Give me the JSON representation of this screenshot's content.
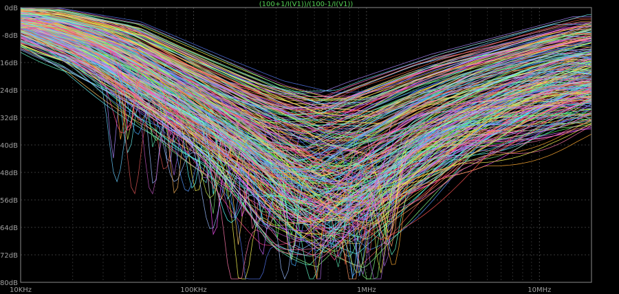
{
  "chart_data": {
    "type": "line",
    "title": "(100+1/I(V1))/(100-1/I(V1))",
    "x_scale": "log",
    "xlim": [
      10000,
      20000000
    ],
    "ylim": [
      -80,
      0
    ],
    "grid": true,
    "x_ticks": [
      {
        "value": 10000,
        "label": "10KHz"
      },
      {
        "value": 100000,
        "label": "100KHz"
      },
      {
        "value": 1000000,
        "label": "1MHz"
      },
      {
        "value": 10000000,
        "label": "10MHz"
      }
    ],
    "y_ticks": [
      {
        "value": 0,
        "label": "0dB"
      },
      {
        "value": -8,
        "label": "-8dB"
      },
      {
        "value": -16,
        "label": "-16dB"
      },
      {
        "value": -24,
        "label": "-24dB"
      },
      {
        "value": -32,
        "label": "-32dB"
      },
      {
        "value": -40,
        "label": "-40dB"
      },
      {
        "value": -48,
        "label": "-48dB"
      },
      {
        "value": -56,
        "label": "-56dB"
      },
      {
        "value": -64,
        "label": "-64dB"
      },
      {
        "value": -72,
        "label": "-72dB"
      },
      {
        "value": -80,
        "label": "-80dB"
      }
    ],
    "series_count": 300,
    "envelope": {
      "x": [
        10000,
        30000,
        100000,
        200000,
        400000,
        700000,
        1000000,
        3000000,
        10000000,
        20000000
      ],
      "upper": [
        0,
        -4,
        -15,
        -21,
        -24.5,
        -24,
        -21,
        -13,
        -6,
        -2
      ],
      "lower": [
        -8,
        -20,
        -40,
        -54,
        -72,
        -77,
        -70,
        -50,
        -40,
        -36
      ]
    },
    "colors": [
      "#ff5555",
      "#55ff55",
      "#5599ff",
      "#ffff55",
      "#ff55ff",
      "#55ffff",
      "#ffaa33",
      "#aa88ff",
      "#ff77aa",
      "#88ff88",
      "#ff9966",
      "#66ccff",
      "#dddd44",
      "#cc66ff",
      "#66ffcc",
      "#ff4488",
      "#44aaff",
      "#ffcc66",
      "#bb55bb",
      "#77dd77",
      "#ee6644",
      "#99bbff",
      "#ccee55",
      "#ff88dd",
      "#55ddaa",
      "#dd5555",
      "#5577ee",
      "#eeaa55",
      "#aa66dd",
      "#66eeee"
    ]
  }
}
